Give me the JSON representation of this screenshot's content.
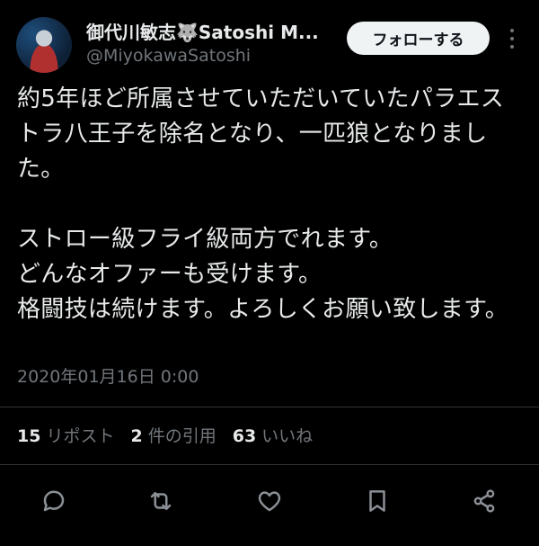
{
  "user": {
    "display_name": "御代川敏志🐺Satoshi M...",
    "handle": "@MiyokawaSatoshi",
    "avatar_icon": "profile-photo"
  },
  "header": {
    "follow_label": "フォローする",
    "more_icon": "more-vertical-icon"
  },
  "tweet": {
    "text": "約5年ほど所属させていただいていたパラエストラ八王子を除名となり、一匹狼となりました。\n\nストロー級フライ級両方でれます。\nどんなオファーも受けます。\n格闘技は続けます。よろしくお願い致します。",
    "timestamp": "2020年01月16日 0:00"
  },
  "stats": {
    "reposts_count": "15",
    "reposts_label": "リポスト",
    "quotes_count": "2",
    "quotes_label": "件の引用",
    "likes_count": "63",
    "likes_label": "いいね"
  },
  "actions": [
    "reply-icon",
    "repost-icon",
    "like-icon",
    "bookmark-icon",
    "share-icon"
  ],
  "colors": {
    "background": "#000000",
    "text": "#e7e9ea",
    "muted": "#71767b",
    "divider": "#2f3336",
    "button_bg": "#eff3f4"
  }
}
